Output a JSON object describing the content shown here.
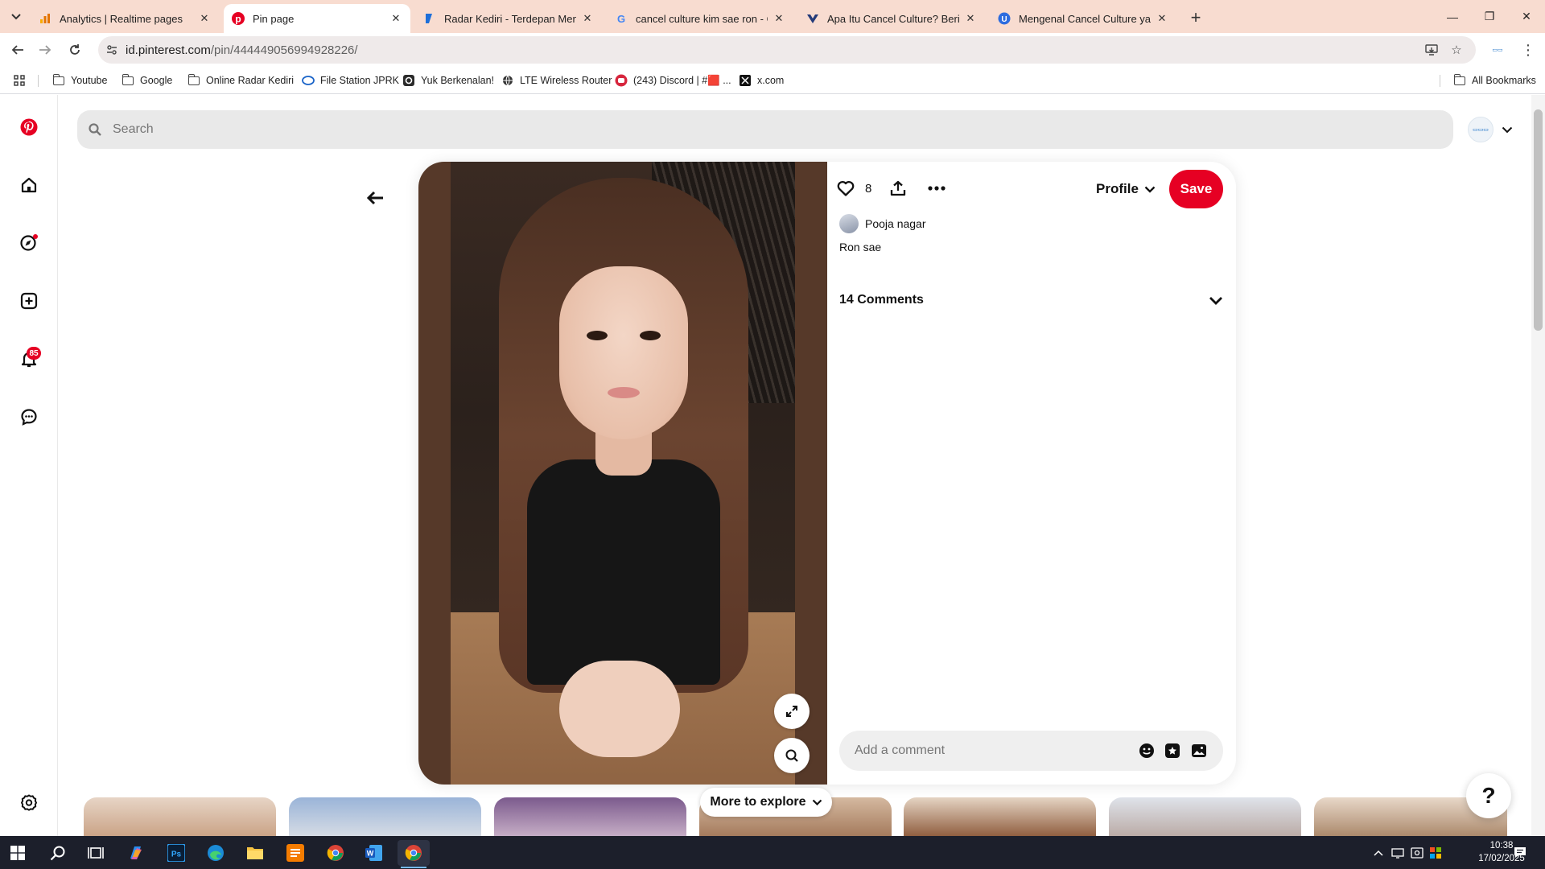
{
  "browser": {
    "tabs": [
      {
        "title": "Analytics | Realtime pages",
        "icon": "analytics-icon",
        "active": false
      },
      {
        "title": "Pin page",
        "icon": "pinterest-icon",
        "active": true
      },
      {
        "title": "Radar Kediri - Terdepan Menga",
        "icon": "radar-kediri-icon",
        "active": false
      },
      {
        "title": "cancel culture kim sae ron - Go",
        "icon": "google-icon",
        "active": false
      },
      {
        "title": "Apa Itu Cancel Culture? Berikut",
        "icon": "site-icon",
        "active": false
      },
      {
        "title": "Mengenal Cancel Culture yang",
        "icon": "site-icon",
        "active": false
      }
    ],
    "url_host": "id.pinterest.com",
    "url_path": "/pin/444449056994928226/",
    "bookmarks": [
      {
        "label": "Youtube",
        "icon": "folder-icon"
      },
      {
        "label": "Google",
        "icon": "folder-icon"
      },
      {
        "label": "Online Radar Kediri",
        "icon": "folder-icon"
      },
      {
        "label": "File Station JPRK",
        "icon": "synology-icon"
      },
      {
        "label": "Yuk Berkenalan!",
        "icon": "site-icon"
      },
      {
        "label": "LTE Wireless Router",
        "icon": "globe-icon"
      },
      {
        "label": "(243) Discord | #🟥 ...",
        "icon": "discord-icon"
      },
      {
        "label": "x.com",
        "icon": "x-icon"
      }
    ],
    "all_bookmarks_label": "All Bookmarks"
  },
  "pinterest": {
    "search_placeholder": "Search",
    "notifications_count": "85",
    "pin": {
      "like_count": "8",
      "profile_label": "Profile",
      "save_label": "Save",
      "creator_name": "Pooja nagar",
      "description": "Ron sae",
      "comments_heading": "14 Comments",
      "comment_placeholder": "Add a comment"
    },
    "more_to_explore_label": "More to explore",
    "help_label": "?"
  },
  "taskbar": {
    "time": "10:38",
    "date": "17/02/2025"
  },
  "colors": {
    "pinterest_red": "#e60023",
    "tab_strip": "#f8dcd0",
    "taskbar": "#1c1f2b",
    "pin_image_backdrop": "#563929"
  }
}
